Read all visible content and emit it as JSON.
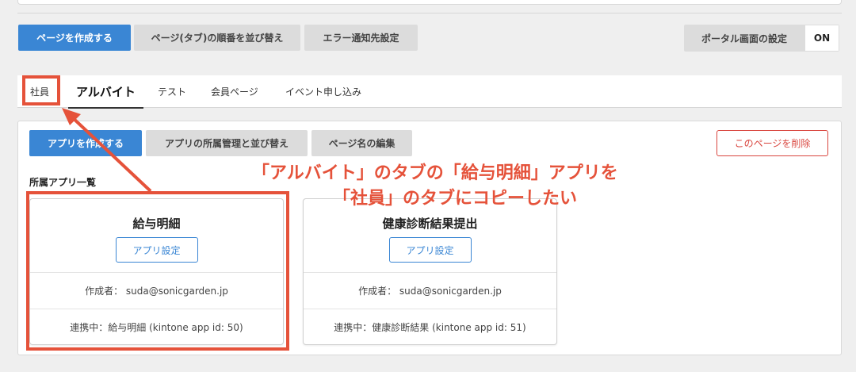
{
  "toolbar": {
    "create_page": "ページを作成する",
    "reorder_pages": "ページ(タブ)の順番を並び替え",
    "error_notify": "エラー通知先設定",
    "portal_settings": "ポータル画面の設定",
    "portal_toggle_state": "ON"
  },
  "tabs": [
    {
      "label": "社員"
    },
    {
      "label": "アルバイト"
    },
    {
      "label": "テスト"
    },
    {
      "label": "会員ページ"
    },
    {
      "label": "イベント申し込み"
    }
  ],
  "panel": {
    "create_app": "アプリを作成する",
    "manage_apps": "アプリの所属管理と並び替え",
    "edit_page_name": "ページ名の編集",
    "delete_page": "このページを削除",
    "section_label": "所属アプリ一覧"
  },
  "apps": [
    {
      "title": "給与明細",
      "settings_label": "アプリ設定",
      "creator": "作成者： suda@sonicgarden.jp",
      "linked": "連携中：給与明細 (kintone app id: 50)"
    },
    {
      "title": "健康診断結果提出",
      "settings_label": "アプリ設定",
      "creator": "作成者： suda@sonicgarden.jp",
      "linked": "連携中：健康診断結果 (kintone app id: 51)"
    }
  ],
  "annotation": {
    "line1": "「アルバイト」のタブの「給与明細」アプリを",
    "line2": "「社員」のタブにコピーしたい"
  },
  "colors": {
    "accent": "#3a86d4",
    "annotation_red": "#e5523a",
    "danger": "#d9463f"
  }
}
